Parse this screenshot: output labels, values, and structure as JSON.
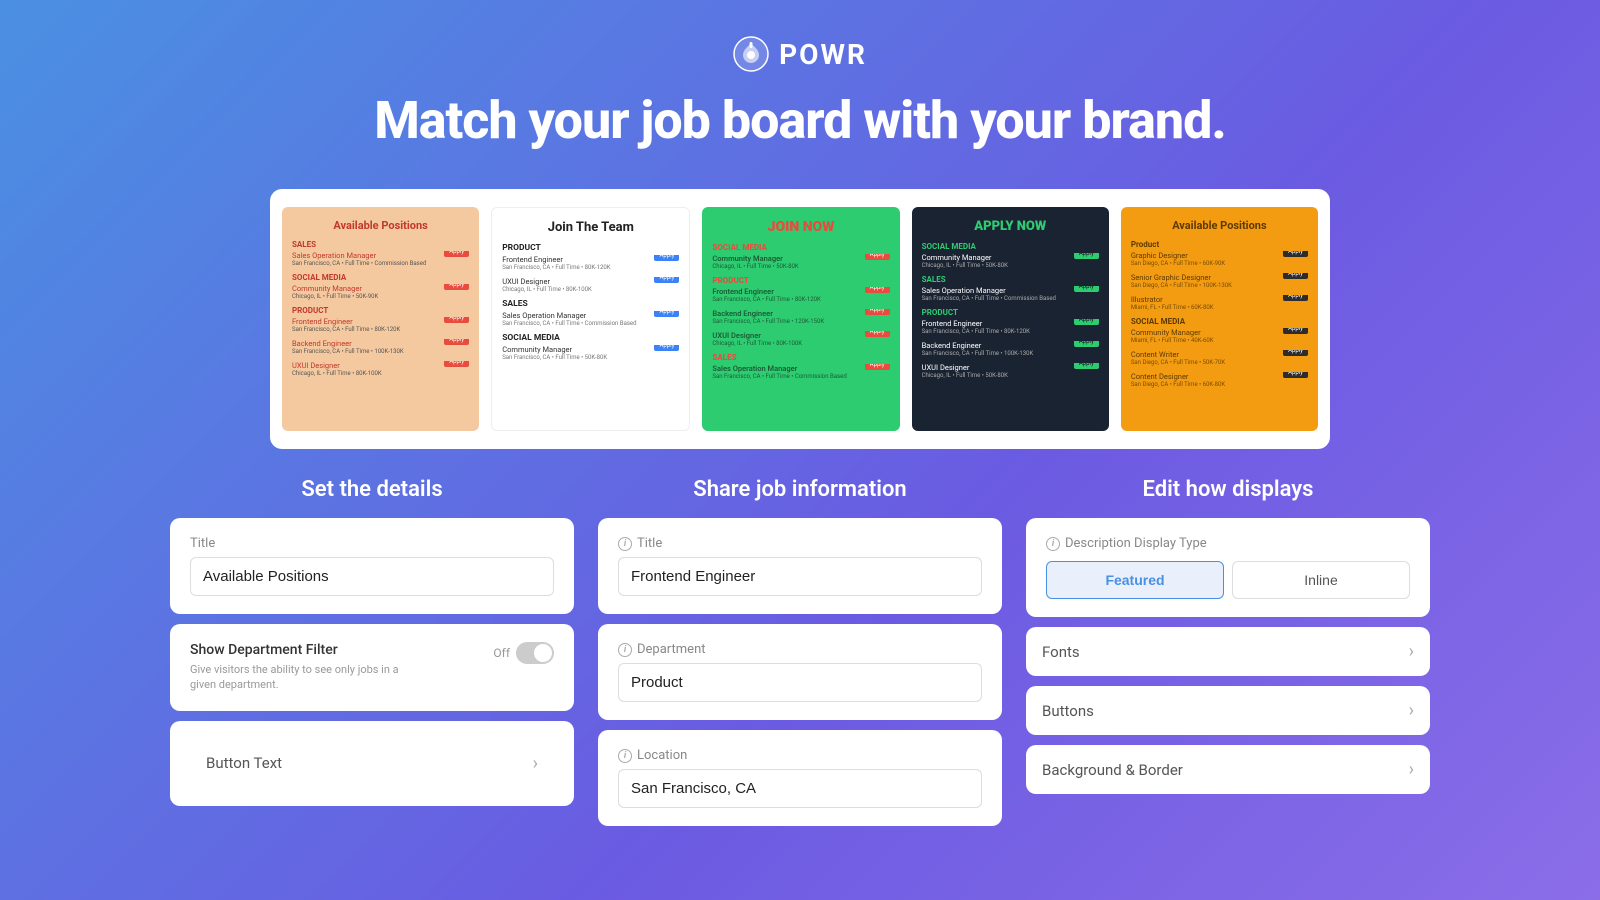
{
  "header": {
    "logo_text": "POWR",
    "headline": "Match your job board with your brand."
  },
  "preview_cards": [
    {
      "id": "card-salmon",
      "title": "Available Positions",
      "sections": [
        {
          "section": "SALES",
          "jobs": [
            {
              "title": "Sales Operation Manager",
              "meta": "San Francisco, CA • Full Time • Commission Based"
            }
          ]
        },
        {
          "section": "SOCIAL MEDIA",
          "jobs": [
            {
              "title": "Community Manager",
              "meta": "Chicago, IL • Full Time • 50K-90K"
            }
          ]
        },
        {
          "section": "PRODUCT",
          "jobs": [
            {
              "title": "Frontend Engineer",
              "meta": "San Francisco, CA • Full Time • 80K-120K"
            },
            {
              "title": "Backend Engineer",
              "meta": "San Francisco, CA • Full Time • 100K-130K"
            },
            {
              "title": "UXUI Designer",
              "meta": "Chicago, IL • Full Time • 80K-100K"
            }
          ]
        }
      ]
    },
    {
      "id": "card-white",
      "title": "Join The Team",
      "sections": [
        {
          "section": "PRODUCT",
          "jobs": [
            {
              "title": "Frontend Engineer",
              "meta": "San Francisco, CA • Full Time • 80K-120K"
            },
            {
              "title": "UXUI Designer",
              "meta": "Chicago, IL • Full Time • 80K-100K"
            }
          ]
        },
        {
          "section": "SALES",
          "jobs": [
            {
              "title": "Sales Operation Manager",
              "meta": "San Francisco, CA • Full Time • Commission Based"
            }
          ]
        },
        {
          "section": "SOCIAL MEDIA",
          "jobs": [
            {
              "title": "Community Manager",
              "meta": "San Francisco, CA • Full Time • 50K-80K"
            }
          ]
        }
      ]
    },
    {
      "id": "card-green",
      "title": "JOIN NOW",
      "sections": [
        {
          "section": "SOCIAL MEDIA",
          "jobs": [
            {
              "title": "Community Manager",
              "meta": "Chicago, IL • Full Time • 50K-80K"
            }
          ]
        },
        {
          "section": "PRODUCT",
          "jobs": [
            {
              "title": "Frontend Engineer",
              "meta": "San Francisco, CA • Full Time • 80K-120K"
            },
            {
              "title": "Backend Engineer",
              "meta": "San Francisco, CA • Full Time • 120K-150K"
            },
            {
              "title": "UXUI Designer",
              "meta": "Chicago, IL • Full Time • 80K-100K"
            }
          ]
        },
        {
          "section": "SALES",
          "jobs": [
            {
              "title": "Sales Operation Manager",
              "meta": "San Francisco, CA • Full Time • Commission Based"
            }
          ]
        }
      ]
    },
    {
      "id": "card-dark",
      "title": "APPLY NOW",
      "sections": [
        {
          "section": "SOCIAL MEDIA",
          "jobs": [
            {
              "title": "Community Manager",
              "meta": "Chicago, IL • Full Time • 50K-80K"
            }
          ]
        },
        {
          "section": "SALES",
          "jobs": [
            {
              "title": "Sales Operation Manager",
              "meta": "San Francisco, CA • Full Time • Commission Based"
            }
          ]
        },
        {
          "section": "PRODUCT",
          "jobs": [
            {
              "title": "Frontend Engineer",
              "meta": "San Francisco, CA • Full Time • 80K-120K"
            },
            {
              "title": "Backend Engineer",
              "meta": "San Francisco, CA • Full Time • 100K-130K"
            },
            {
              "title": "UXUI Designer",
              "meta": "Chicago, IL • Full Time • 50K-80K"
            }
          ]
        }
      ]
    },
    {
      "id": "card-yellow",
      "title": "Available Positions",
      "sections": [
        {
          "section": "Product",
          "jobs": [
            {
              "title": "Graphic Designer",
              "meta": "San Diego, CA • Full Time • 60K-90K"
            },
            {
              "title": "Senior Graphic Designer",
              "meta": "San Diego, CA • Full Time • 100K-130K"
            },
            {
              "title": "Illustrator",
              "meta": "Miami, FL • Full Time • 60K-80K"
            }
          ]
        },
        {
          "section": "SOCIAL MEDIA",
          "jobs": [
            {
              "title": "Community Manager",
              "meta": "Miami, FL • Full Time • 40K-60K"
            },
            {
              "title": "Content Writer",
              "meta": "San Diego, CA • Full Time • 50K-70K"
            },
            {
              "title": "Content Designer",
              "meta": "San Diego, CA • Full Time • 60K-80K"
            }
          ]
        }
      ]
    }
  ],
  "panels": {
    "set_details": {
      "title": "Set the details",
      "title_label": "Title",
      "title_value": "Available Positions",
      "department_filter_label": "Show Department Filter",
      "department_filter_desc": "Give visitors the ability to see only jobs in a given department.",
      "toggle_state": "Off",
      "button_text_label": "Button Text"
    },
    "share_info": {
      "title": "Share job information",
      "title_label": "Title",
      "title_value": "Frontend Engineer",
      "department_label": "Department",
      "department_value": "Product",
      "location_label": "Location",
      "location_value": "San Francisco, CA"
    },
    "edit_display": {
      "title": "Edit how displays",
      "desc_type_label": "Description Display Type",
      "featured_label": "Featured",
      "inline_label": "Inline",
      "fonts_label": "Fonts",
      "buttons_label": "Buttons",
      "background_border_label": "Background & Border"
    }
  }
}
